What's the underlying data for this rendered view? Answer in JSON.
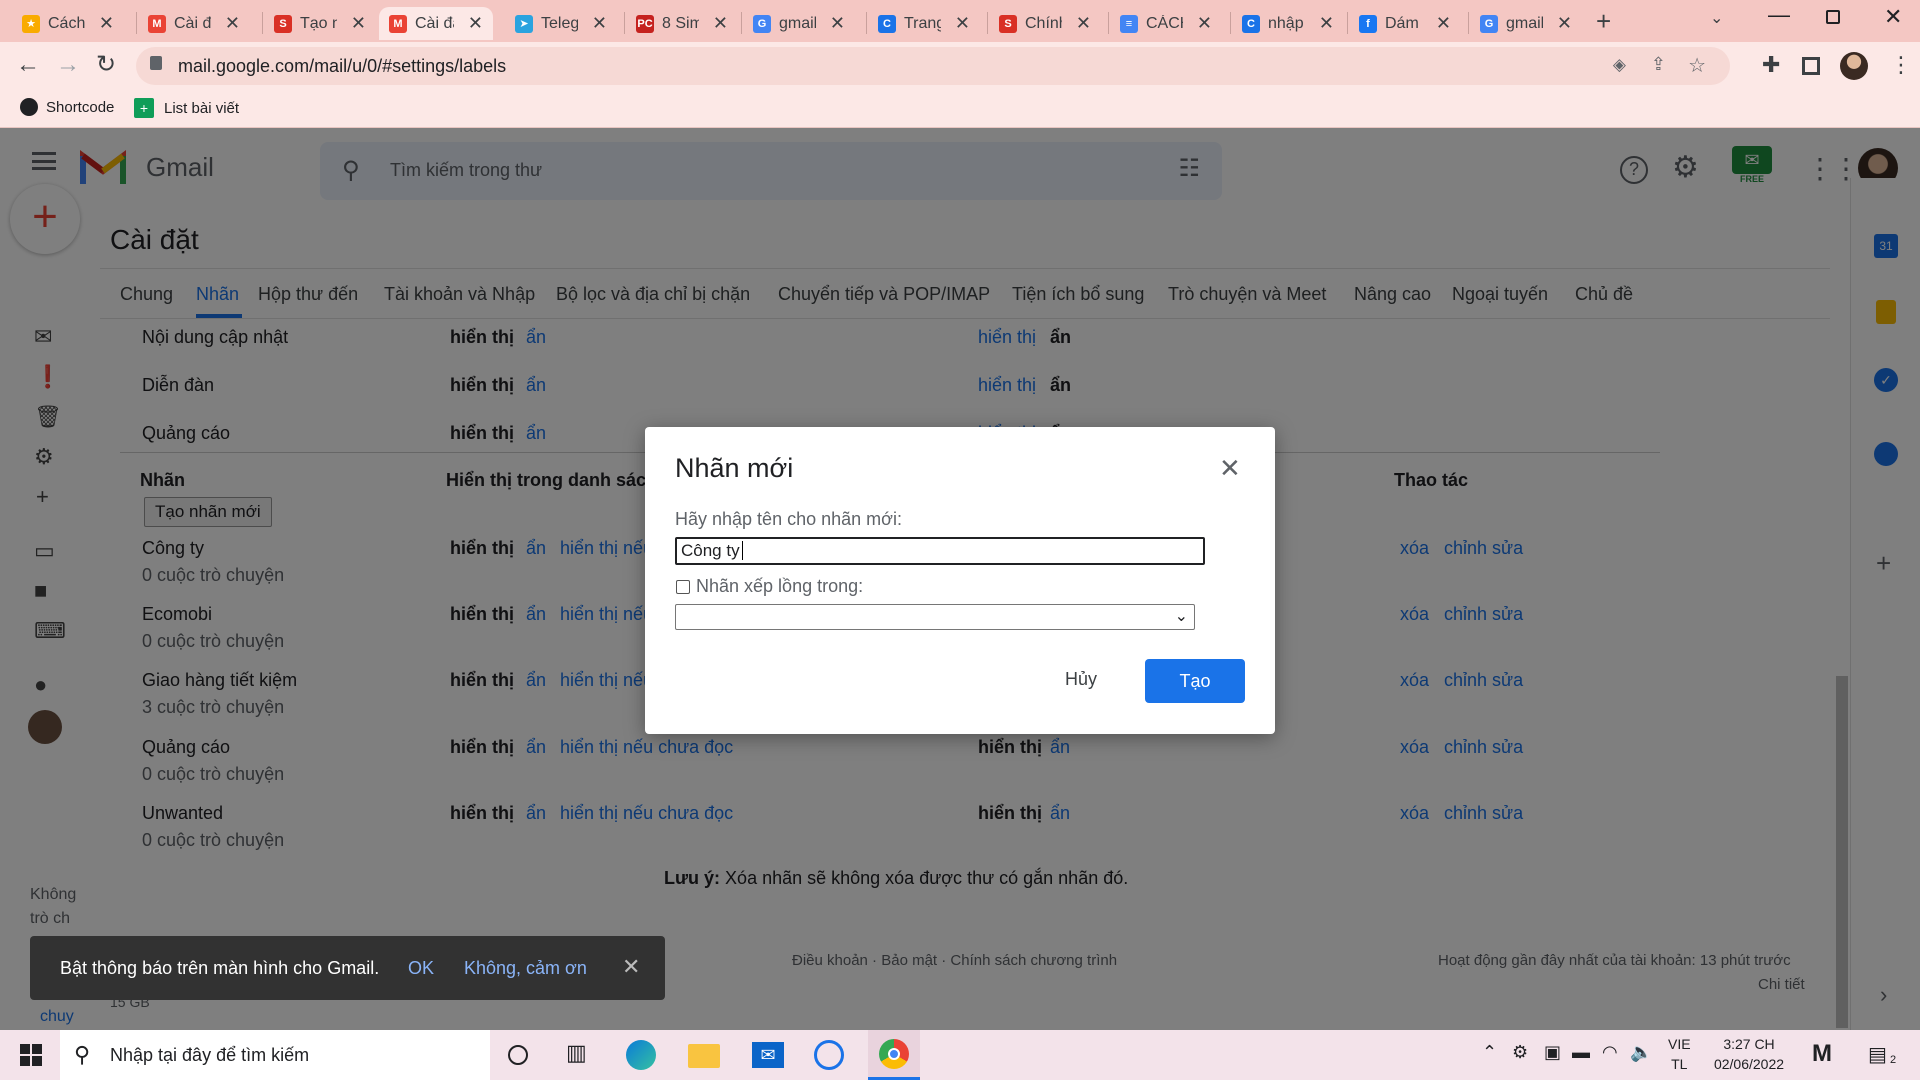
{
  "browser": {
    "tabs": [
      {
        "label": "Cách t",
        "color": "#f9ab00",
        "glyph": "★"
      },
      {
        "label": "Cài đặ",
        "color": "#ea4335",
        "glyph": "M"
      },
      {
        "label": "Tạo ng",
        "color": "#d93025",
        "glyph": "S"
      },
      {
        "label": "Cài đặ",
        "color": "#ea4335",
        "glyph": "M"
      },
      {
        "label": "Telegr",
        "color": "#2aa3df",
        "glyph": "➤"
      },
      {
        "label": "8 Sim",
        "color": "#c5221f",
        "glyph": "PC"
      },
      {
        "label": "gmail",
        "color": "#4285f4",
        "glyph": "G"
      },
      {
        "label": "Trang",
        "color": "#1a73e8",
        "glyph": "C"
      },
      {
        "label": "Chính",
        "color": "#d93025",
        "glyph": "S"
      },
      {
        "label": "CÁCH",
        "color": "#4285f4",
        "glyph": "≡"
      },
      {
        "label": "nhập",
        "color": "#1a73e8",
        "glyph": "C"
      },
      {
        "label": "Dám l",
        "color": "#1877f2",
        "glyph": "f"
      },
      {
        "label": "gmail",
        "color": "#4285f4",
        "glyph": "G"
      }
    ],
    "url": "mail.google.com/mail/u/0/#settings/labels",
    "bookmarks": [
      {
        "label": "Shortcode"
      },
      {
        "label": "List bài viết"
      }
    ]
  },
  "gmail": {
    "logo_text": "Gmail",
    "search_placeholder": "Tìm kiếm trong thư",
    "free_badge": "FREE",
    "page_title": "Cài đặt",
    "settings_tabs": [
      "Chung",
      "Nhãn",
      "Hộp thư đến",
      "Tài khoản và Nhập",
      "Bộ lọc và địa chỉ bị chặn",
      "Chuyển tiếp và POP/IMAP",
      "Tiện ích bổ sung",
      "Trò chuyện và Meet",
      "Nâng cao",
      "Ngoại tuyến",
      "Chủ đề"
    ],
    "category_rows": [
      {
        "name": "Nội dung cập nhật",
        "show": "hiển thị",
        "hide": "ẩn",
        "show2": "hiển thị",
        "hide2": "ẩn"
      },
      {
        "name": "Diễn đàn",
        "show": "hiển thị",
        "hide": "ẩn",
        "show2": "hiển thị",
        "hide2": "ẩn"
      },
      {
        "name": "Quảng cáo",
        "show": "hiển thị",
        "hide": "ẩn",
        "show2": "hiển thị",
        "hide2": "ẩn"
      }
    ],
    "labels_header": {
      "col1": "Nhãn",
      "col2": "Hiển thị trong danh sách n",
      "col4": "Thao tác",
      "create_button": "Tạo nhãn mới"
    },
    "label_rows": [
      {
        "name": "Công ty",
        "count": "0 cuộc trò chuyện",
        "show": "hiển thị",
        "hide": "ẩn",
        "unread": "hiển thị nếu",
        "show2": "",
        "hide2": "",
        "delete": "xóa",
        "edit": "chỉnh sửa"
      },
      {
        "name": "Ecomobi",
        "count": "0 cuộc trò chuyện",
        "show": "hiển thị",
        "hide": "ẩn",
        "unread": "hiển thị nếu",
        "show2": "",
        "hide2": "",
        "delete": "xóa",
        "edit": "chỉnh sửa"
      },
      {
        "name": "Giao hàng tiết kiệm",
        "count": "3 cuộc trò chuyện",
        "show": "hiển thị",
        "hide": "ẩn",
        "unread": "hiển thị nếu",
        "show2": "",
        "hide2": "",
        "delete": "xóa",
        "edit": "chỉnh sửa"
      },
      {
        "name": "Quảng cáo",
        "count": "0 cuộc trò chuyện",
        "show": "hiển thị",
        "hide": "ẩn",
        "unread": "hiển thị nếu chưa đọc",
        "show2": "hiển thị",
        "hide2": "ẩn",
        "delete": "xóa",
        "edit": "chỉnh sửa"
      },
      {
        "name": "Unwanted",
        "count": "0 cuộc trò chuyện",
        "show": "hiển thị",
        "hide": "ẩn",
        "unread": "hiển thị nếu chưa đọc",
        "show2": "hiển thị",
        "hide2": "ẩn",
        "delete": "xóa",
        "edit": "chỉnh sửa"
      }
    ],
    "note_bold": "Lưu ý:",
    "note_text": "Xóa nhãn sẽ không xóa được thư có gắn nhãn đó.",
    "footer_links": "Điều khoản · Bảo mật · Chính sách chương trình",
    "last_activity": "Hoạt động gần đây nhất của tài khoản: 13 phút trước",
    "details_link": "Chi tiết",
    "storage": "15 GB",
    "sidebar_text1": "Không",
    "sidebar_text2": "trò ch",
    "sidebar_link": "chuy"
  },
  "dialog": {
    "title": "Nhãn mới",
    "name_label": "Hãy nhập tên cho nhãn mới:",
    "name_value": "Công ty",
    "nest_label": "Nhãn xếp lồng trong:",
    "nest_checked": false,
    "parent_value": "",
    "cancel": "Hủy",
    "create": "Tạo"
  },
  "toast": {
    "message": "Bật thông báo trên màn hình cho Gmail.",
    "ok": "OK",
    "decline": "Không, cảm ơn"
  },
  "taskbar": {
    "search_placeholder": "Nhập tại đây để tìm kiếm",
    "lang_top": "VIE",
    "lang_bottom": "TL",
    "time": "3:27 CH",
    "date": "02/06/2022",
    "notification_count": "2"
  }
}
